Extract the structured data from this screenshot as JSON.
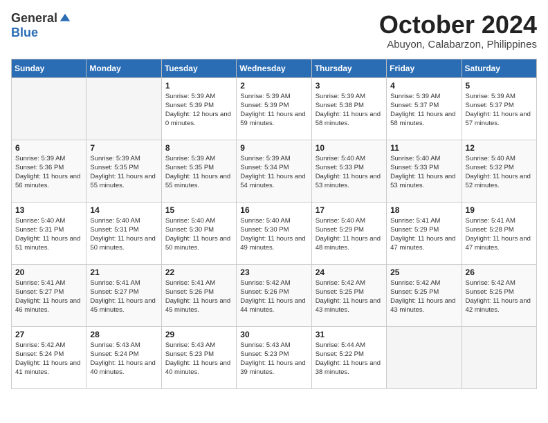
{
  "header": {
    "logo_general": "General",
    "logo_blue": "Blue",
    "month": "October 2024",
    "location": "Abuyon, Calabarzon, Philippines"
  },
  "days_of_week": [
    "Sunday",
    "Monday",
    "Tuesday",
    "Wednesday",
    "Thursday",
    "Friday",
    "Saturday"
  ],
  "weeks": [
    [
      {
        "day": "",
        "empty": true
      },
      {
        "day": "",
        "empty": true
      },
      {
        "day": "1",
        "sunrise": "Sunrise: 5:39 AM",
        "sunset": "Sunset: 5:39 PM",
        "daylight": "Daylight: 12 hours and 0 minutes."
      },
      {
        "day": "2",
        "sunrise": "Sunrise: 5:39 AM",
        "sunset": "Sunset: 5:39 PM",
        "daylight": "Daylight: 11 hours and 59 minutes."
      },
      {
        "day": "3",
        "sunrise": "Sunrise: 5:39 AM",
        "sunset": "Sunset: 5:38 PM",
        "daylight": "Daylight: 11 hours and 58 minutes."
      },
      {
        "day": "4",
        "sunrise": "Sunrise: 5:39 AM",
        "sunset": "Sunset: 5:37 PM",
        "daylight": "Daylight: 11 hours and 58 minutes."
      },
      {
        "day": "5",
        "sunrise": "Sunrise: 5:39 AM",
        "sunset": "Sunset: 5:37 PM",
        "daylight": "Daylight: 11 hours and 57 minutes."
      }
    ],
    [
      {
        "day": "6",
        "sunrise": "Sunrise: 5:39 AM",
        "sunset": "Sunset: 5:36 PM",
        "daylight": "Daylight: 11 hours and 56 minutes."
      },
      {
        "day": "7",
        "sunrise": "Sunrise: 5:39 AM",
        "sunset": "Sunset: 5:35 PM",
        "daylight": "Daylight: 11 hours and 55 minutes."
      },
      {
        "day": "8",
        "sunrise": "Sunrise: 5:39 AM",
        "sunset": "Sunset: 5:35 PM",
        "daylight": "Daylight: 11 hours and 55 minutes."
      },
      {
        "day": "9",
        "sunrise": "Sunrise: 5:39 AM",
        "sunset": "Sunset: 5:34 PM",
        "daylight": "Daylight: 11 hours and 54 minutes."
      },
      {
        "day": "10",
        "sunrise": "Sunrise: 5:40 AM",
        "sunset": "Sunset: 5:33 PM",
        "daylight": "Daylight: 11 hours and 53 minutes."
      },
      {
        "day": "11",
        "sunrise": "Sunrise: 5:40 AM",
        "sunset": "Sunset: 5:33 PM",
        "daylight": "Daylight: 11 hours and 53 minutes."
      },
      {
        "day": "12",
        "sunrise": "Sunrise: 5:40 AM",
        "sunset": "Sunset: 5:32 PM",
        "daylight": "Daylight: 11 hours and 52 minutes."
      }
    ],
    [
      {
        "day": "13",
        "sunrise": "Sunrise: 5:40 AM",
        "sunset": "Sunset: 5:31 PM",
        "daylight": "Daylight: 11 hours and 51 minutes."
      },
      {
        "day": "14",
        "sunrise": "Sunrise: 5:40 AM",
        "sunset": "Sunset: 5:31 PM",
        "daylight": "Daylight: 11 hours and 50 minutes."
      },
      {
        "day": "15",
        "sunrise": "Sunrise: 5:40 AM",
        "sunset": "Sunset: 5:30 PM",
        "daylight": "Daylight: 11 hours and 50 minutes."
      },
      {
        "day": "16",
        "sunrise": "Sunrise: 5:40 AM",
        "sunset": "Sunset: 5:30 PM",
        "daylight": "Daylight: 11 hours and 49 minutes."
      },
      {
        "day": "17",
        "sunrise": "Sunrise: 5:40 AM",
        "sunset": "Sunset: 5:29 PM",
        "daylight": "Daylight: 11 hours and 48 minutes."
      },
      {
        "day": "18",
        "sunrise": "Sunrise: 5:41 AM",
        "sunset": "Sunset: 5:29 PM",
        "daylight": "Daylight: 11 hours and 47 minutes."
      },
      {
        "day": "19",
        "sunrise": "Sunrise: 5:41 AM",
        "sunset": "Sunset: 5:28 PM",
        "daylight": "Daylight: 11 hours and 47 minutes."
      }
    ],
    [
      {
        "day": "20",
        "sunrise": "Sunrise: 5:41 AM",
        "sunset": "Sunset: 5:27 PM",
        "daylight": "Daylight: 11 hours and 46 minutes."
      },
      {
        "day": "21",
        "sunrise": "Sunrise: 5:41 AM",
        "sunset": "Sunset: 5:27 PM",
        "daylight": "Daylight: 11 hours and 45 minutes."
      },
      {
        "day": "22",
        "sunrise": "Sunrise: 5:41 AM",
        "sunset": "Sunset: 5:26 PM",
        "daylight": "Daylight: 11 hours and 45 minutes."
      },
      {
        "day": "23",
        "sunrise": "Sunrise: 5:42 AM",
        "sunset": "Sunset: 5:26 PM",
        "daylight": "Daylight: 11 hours and 44 minutes."
      },
      {
        "day": "24",
        "sunrise": "Sunrise: 5:42 AM",
        "sunset": "Sunset: 5:25 PM",
        "daylight": "Daylight: 11 hours and 43 minutes."
      },
      {
        "day": "25",
        "sunrise": "Sunrise: 5:42 AM",
        "sunset": "Sunset: 5:25 PM",
        "daylight": "Daylight: 11 hours and 43 minutes."
      },
      {
        "day": "26",
        "sunrise": "Sunrise: 5:42 AM",
        "sunset": "Sunset: 5:25 PM",
        "daylight": "Daylight: 11 hours and 42 minutes."
      }
    ],
    [
      {
        "day": "27",
        "sunrise": "Sunrise: 5:42 AM",
        "sunset": "Sunset: 5:24 PM",
        "daylight": "Daylight: 11 hours and 41 minutes."
      },
      {
        "day": "28",
        "sunrise": "Sunrise: 5:43 AM",
        "sunset": "Sunset: 5:24 PM",
        "daylight": "Daylight: 11 hours and 40 minutes."
      },
      {
        "day": "29",
        "sunrise": "Sunrise: 5:43 AM",
        "sunset": "Sunset: 5:23 PM",
        "daylight": "Daylight: 11 hours and 40 minutes."
      },
      {
        "day": "30",
        "sunrise": "Sunrise: 5:43 AM",
        "sunset": "Sunset: 5:23 PM",
        "daylight": "Daylight: 11 hours and 39 minutes."
      },
      {
        "day": "31",
        "sunrise": "Sunrise: 5:44 AM",
        "sunset": "Sunset: 5:22 PM",
        "daylight": "Daylight: 11 hours and 38 minutes."
      },
      {
        "day": "",
        "empty": true
      },
      {
        "day": "",
        "empty": true
      }
    ]
  ]
}
